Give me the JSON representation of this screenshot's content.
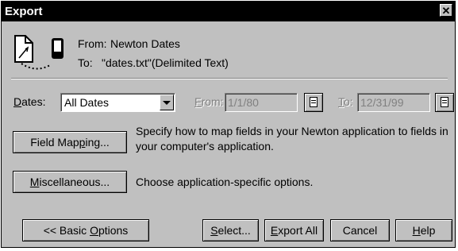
{
  "window": {
    "title": "Export",
    "close_glyph": "✕"
  },
  "transfer": {
    "from_label": "From:",
    "from_value": "Newton Dates",
    "to_label": "To:",
    "to_value": "\"dates.txt\"(Delimited Text)",
    "icon": "newton-to-document-transfer-icon"
  },
  "dates": {
    "label_mnemonic": "D",
    "label_rest": "ates:",
    "selected": "All Dates",
    "from_label_mnemonic": "F",
    "from_label_rest": "rom:",
    "from_value": "1/1/80",
    "to_label_mnemonic": "T",
    "to_label_rest": "o:",
    "to_value": "12/31/99"
  },
  "field_mapping": {
    "button_before": "Field Map",
    "button_mnemonic": "p",
    "button_after": "ing...",
    "description_line1": "Specify how to map fields in your Newton application to fields in",
    "description_line2": "your computer's application."
  },
  "miscellaneous": {
    "button_mnemonic": "M",
    "button_after": "iscellaneous...",
    "description": "Choose application-specific options."
  },
  "footer": {
    "basic_before": "<< Basic ",
    "basic_mnemonic": "O",
    "basic_after": "ptions",
    "select_mnemonic": "S",
    "select_after": "elect...",
    "export_mnemonic": "E",
    "export_after": "xport All",
    "cancel": "Cancel",
    "help_mnemonic": "H",
    "help_after": "elp"
  }
}
